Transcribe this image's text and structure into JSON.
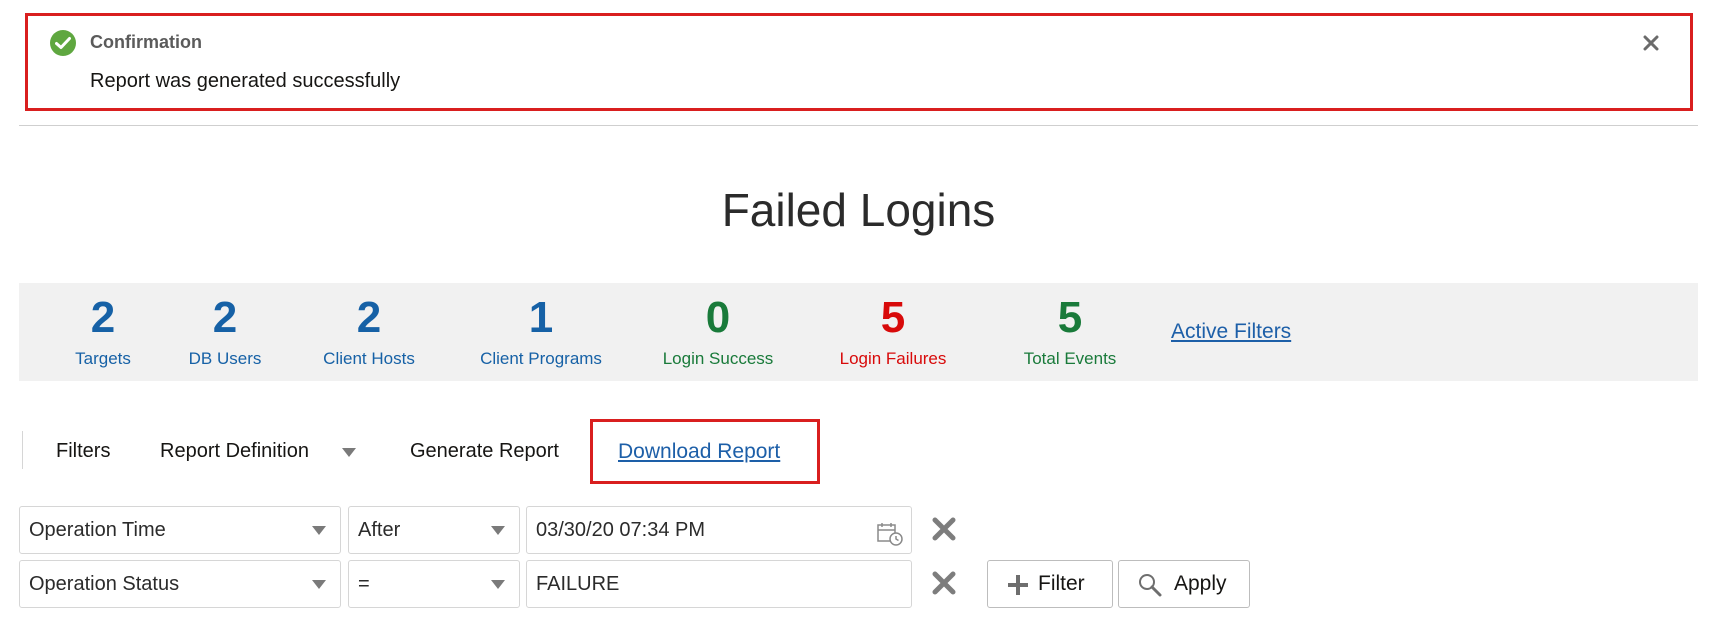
{
  "confirmation": {
    "title": "Confirmation",
    "message": "Report was generated successfully",
    "icon": "check-circle-icon",
    "close_icon": "close-icon"
  },
  "page": {
    "title": "Failed Logins"
  },
  "summary": {
    "stats": [
      {
        "value": "2",
        "label": "Targets",
        "color": "#1661a6"
      },
      {
        "value": "2",
        "label": "DB Users",
        "color": "#1661a6"
      },
      {
        "value": "2",
        "label": "Client Hosts",
        "color": "#1661a6"
      },
      {
        "value": "1",
        "label": "Client Programs",
        "color": "#1661a6"
      },
      {
        "value": "0",
        "label": "Login Success",
        "color": "#197a3a"
      },
      {
        "value": "5",
        "label": "Login Failures",
        "color": "#d80a0a"
      },
      {
        "value": "5",
        "label": "Total Events",
        "color": "#197a3a"
      }
    ],
    "active_filters_link": "Active Filters"
  },
  "toolbar": {
    "filters": "Filters",
    "report_definition": "Report Definition",
    "generate_report": "Generate Report",
    "download_report": "Download Report"
  },
  "filters": {
    "rows": [
      {
        "field": "Operation Time",
        "operator": "After",
        "value": "03/30/20 07:34 PM"
      },
      {
        "field": "Operation Status",
        "operator": "=",
        "value": "FAILURE"
      }
    ],
    "add_filter_label": "Filter",
    "apply_label": "Apply"
  }
}
